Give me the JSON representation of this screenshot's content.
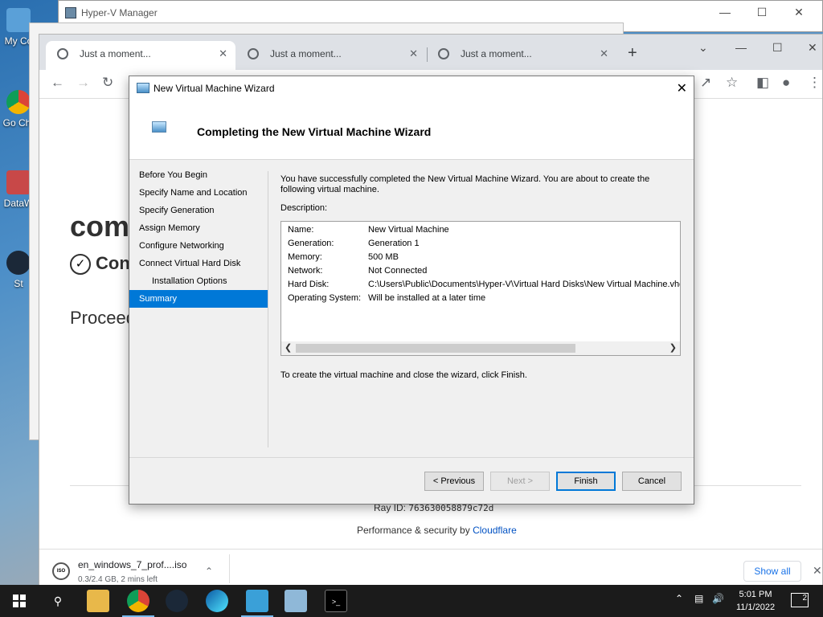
{
  "desktop": {
    "icons": [
      {
        "label": "My Co",
        "icon": "computer-icon"
      },
      {
        "label": "Go Chr",
        "icon": "chrome-shortcut-icon"
      },
      {
        "label": "DataW",
        "icon": "datawarehouse-icon"
      },
      {
        "label": "St",
        "icon": "steam-shortcut-icon"
      }
    ]
  },
  "hyperv": {
    "title": "Hyper-V Manager"
  },
  "chrome": {
    "tabs": [
      {
        "label": "Just a moment..."
      },
      {
        "label": "Just a moment..."
      },
      {
        "label": "Just a moment..."
      }
    ],
    "page": {
      "heading": "com",
      "sub": "Con",
      "proceed": "Proceed",
      "ray_label": "Ray ID:",
      "ray_id": "763630058879c72d",
      "perf_label": "Performance & security by",
      "perf_link": "Cloudflare"
    },
    "download": {
      "filename": "en_windows_7_prof....iso",
      "status": "0.3/2.4 GB, 2 mins left",
      "icon_text": "ISO",
      "show_all": "Show all"
    }
  },
  "wizard": {
    "title": "New Virtual Machine Wizard",
    "header": "Completing the New Virtual Machine Wizard",
    "nav": [
      {
        "label": "Before You Begin",
        "sub": false,
        "active": false
      },
      {
        "label": "Specify Name and Location",
        "sub": false,
        "active": false
      },
      {
        "label": "Specify Generation",
        "sub": false,
        "active": false
      },
      {
        "label": "Assign Memory",
        "sub": false,
        "active": false
      },
      {
        "label": "Configure Networking",
        "sub": false,
        "active": false
      },
      {
        "label": "Connect Virtual Hard Disk",
        "sub": false,
        "active": false
      },
      {
        "label": "Installation Options",
        "sub": true,
        "active": false
      },
      {
        "label": "Summary",
        "sub": false,
        "active": true
      }
    ],
    "intro": "You have successfully completed the New Virtual Machine Wizard. You are about to create the following virtual machine.",
    "description_label": "Description:",
    "summary": [
      {
        "key": "Name:",
        "value": "New Virtual Machine"
      },
      {
        "key": "Generation:",
        "value": "Generation 1"
      },
      {
        "key": "Memory:",
        "value": "500 MB"
      },
      {
        "key": "Network:",
        "value": "Not Connected"
      },
      {
        "key": "Hard Disk:",
        "value": "C:\\Users\\Public\\Documents\\Hyper-V\\Virtual Hard Disks\\New Virtual Machine.vhdx"
      },
      {
        "key": "Operating System:",
        "value": "Will be installed at a later time"
      }
    ],
    "footer_text": "To create the virtual machine and close the wizard, click Finish.",
    "buttons": {
      "previous": "< Previous",
      "next": "Next >",
      "finish": "Finish",
      "cancel": "Cancel"
    }
  },
  "taskbar": {
    "time": "5:01 PM",
    "date": "11/1/2022",
    "notifications": "2"
  }
}
